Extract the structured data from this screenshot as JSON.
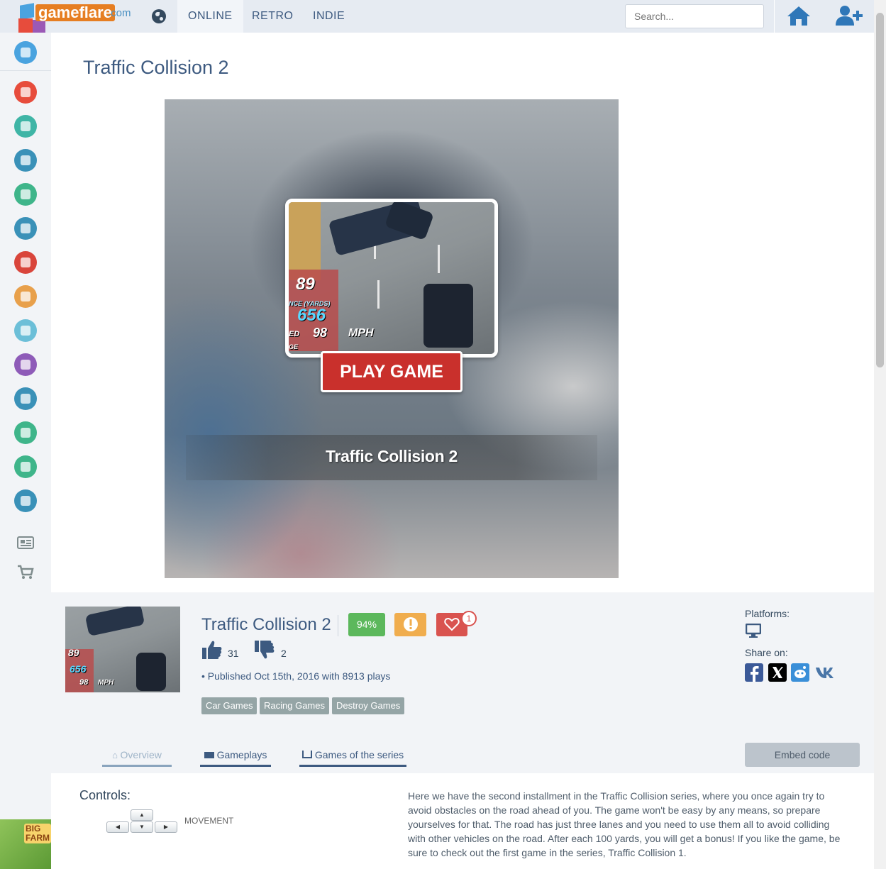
{
  "header": {
    "logo_text": "gameflare",
    "logo_domain": ".com",
    "nav": [
      {
        "label": "ONLINE",
        "active": true
      },
      {
        "label": "RETRO",
        "active": false
      },
      {
        "label": "INDIE",
        "active": false
      }
    ],
    "search_placeholder": "Search..."
  },
  "sidebar": {
    "categories": [
      {
        "icon": "youtube-icon",
        "color": "#e74c3c"
      },
      {
        "icon": "3d-glasses-icon",
        "color": "#3fb5a6"
      },
      {
        "icon": "animal-icon",
        "color": "#3a91b8"
      },
      {
        "icon": "car-icon",
        "color": "#3fb58a"
      },
      {
        "icon": "gamepad-icon",
        "color": "#3a91b8"
      },
      {
        "icon": "clown-icon",
        "color": "#d9453b"
      },
      {
        "icon": "girl-icon",
        "color": "#e8a04b"
      },
      {
        "icon": "people-icon",
        "color": "#6cbfd8"
      },
      {
        "icon": "hat-icon",
        "color": "#8e5bb8"
      },
      {
        "icon": "puzzle-icon",
        "color": "#3a91b8"
      },
      {
        "icon": "target-icon",
        "color": "#3fb58a"
      },
      {
        "icon": "football-icon",
        "color": "#3fb58a"
      },
      {
        "icon": "castle-icon",
        "color": "#3a91b8"
      }
    ]
  },
  "game": {
    "title": "Traffic Collision 2",
    "play_label": "PLAY GAME",
    "hud": {
      "score": "89",
      "distance_label": "NCE (YARDS)",
      "distance": "656",
      "speed": "98",
      "speed_unit": "MPH",
      "speed_prefix": "ED",
      "side_text": "GE"
    },
    "rating": "94%",
    "favorites": "1",
    "likes": "31",
    "dislikes": "2",
    "published": "• Published Oct 15th, 2016 with 8913 plays",
    "tags": [
      "Car Games",
      "Racing Games",
      "Destroy Games"
    ],
    "platforms_label": "Platforms:",
    "share_label": "Share on:"
  },
  "tabs": [
    {
      "label": "Overview",
      "active": true
    },
    {
      "label": "Gameplays",
      "active": false
    },
    {
      "label": "Games of the series",
      "active": false
    }
  ],
  "embed_label": "Embed code",
  "controls": {
    "label": "Controls:",
    "movement": "MOVEMENT"
  },
  "description": "Here we have the second installment in the Traffic Collision series, where you once again try to avoid obstacles on the road ahead of you. The game won't be easy by any means, so prepare yourselves for that. The road has just three lanes and you need to use them all to avoid colliding with other vehicles on the road. After each 100 yards, you will get a bonus! If you like the game, be sure to check out the first game in the series, Traffic Collision 1.",
  "ad_text": "BIG FARM"
}
